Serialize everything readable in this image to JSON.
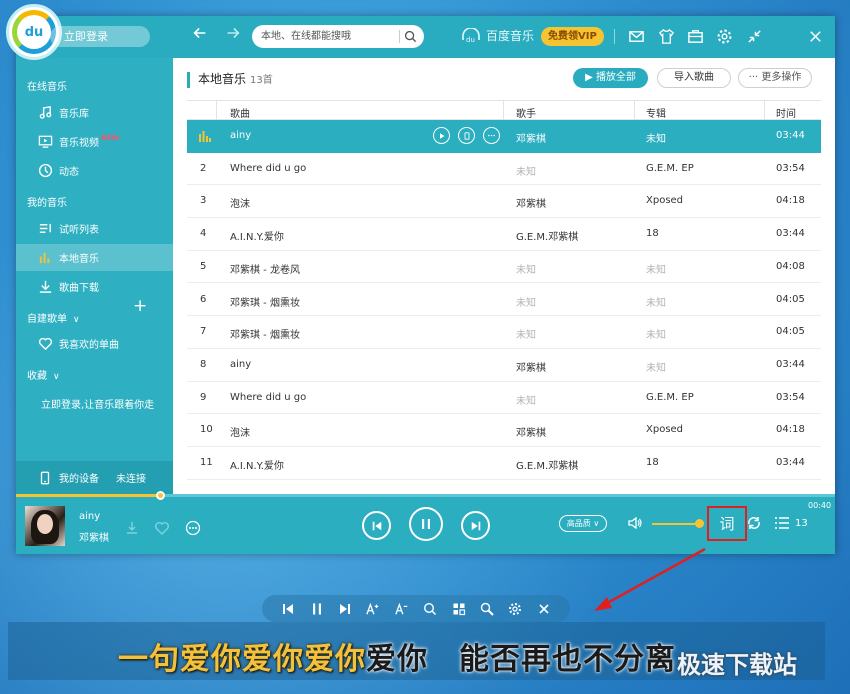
{
  "topbar": {
    "login_label": "立即登录",
    "search_placeholder": "本地、在线都能搜哦",
    "brand": "百度音乐",
    "vip_label": "免费领VIP"
  },
  "sidebar": {
    "section_online": "在线音乐",
    "item_library": "音乐库",
    "item_mv": "音乐视频",
    "new_badge": "NEW",
    "item_feed": "动态",
    "section_mine": "我的音乐",
    "item_trial": "试听列表",
    "item_local": "本地音乐",
    "item_download": "歌曲下载",
    "section_custom": "自建歌单",
    "item_fav": "我喜欢的单曲",
    "section_collect": "收藏",
    "login_hint": "立即登录,让音乐跟着你走",
    "device_label": "我的设备",
    "device_status": "未连接"
  },
  "content": {
    "title": "本地音乐",
    "count": "13首",
    "play_all": "播放全部",
    "import": "导入歌曲",
    "more": "··· 更多操作",
    "headers": {
      "song": "歌曲",
      "artist": "歌手",
      "album": "专辑",
      "time": "时间"
    },
    "rows": [
      {
        "num": "",
        "song": "ainy",
        "artist": "邓紫棋",
        "album": "未知",
        "time": "03:44",
        "artist_dim": false,
        "album_dim": false
      },
      {
        "num": "2",
        "song": "Where did u go",
        "artist": "未知",
        "album": "G.E.M. EP",
        "time": "03:54",
        "artist_dim": true,
        "album_dim": false
      },
      {
        "num": "3",
        "song": "泡沫",
        "artist": "邓紫棋",
        "album": "Xposed",
        "time": "04:18",
        "artist_dim": false,
        "album_dim": false
      },
      {
        "num": "4",
        "song": "A.I.N.Y.爱你",
        "artist": "G.E.M.邓紫棋",
        "album": "18",
        "time": "03:44",
        "artist_dim": false,
        "album_dim": false
      },
      {
        "num": "5",
        "song": "邓紫棋 - 龙卷风",
        "artist": "未知",
        "album": "未知",
        "time": "04:08",
        "artist_dim": true,
        "album_dim": true
      },
      {
        "num": "6",
        "song": "邓紫琪 - 烟熏妆",
        "artist": "未知",
        "album": "未知",
        "time": "04:05",
        "artist_dim": true,
        "album_dim": true
      },
      {
        "num": "7",
        "song": "邓紫琪 - 烟熏妆",
        "artist": "未知",
        "album": "未知",
        "time": "04:05",
        "artist_dim": true,
        "album_dim": true
      },
      {
        "num": "8",
        "song": "ainy",
        "artist": "邓紫棋",
        "album": "未知",
        "time": "03:44",
        "artist_dim": false,
        "album_dim": true
      },
      {
        "num": "9",
        "song": "Where did u go",
        "artist": "未知",
        "album": "G.E.M. EP",
        "time": "03:54",
        "artist_dim": true,
        "album_dim": false
      },
      {
        "num": "10",
        "song": "泡沫",
        "artist": "邓紫棋",
        "album": "Xposed",
        "time": "04:18",
        "artist_dim": false,
        "album_dim": false
      },
      {
        "num": "11",
        "song": "A.I.N.Y.爱你",
        "artist": "G.E.M.邓紫棋",
        "album": "18",
        "time": "03:44",
        "artist_dim": false,
        "album_dim": false
      }
    ]
  },
  "player": {
    "total_time": "00:40",
    "progress": 0.177,
    "song": "ainy",
    "artist": "邓紫棋",
    "quality": "高品质",
    "volume": 1.0,
    "lyric_button": "词",
    "queue_count": "13"
  },
  "lyrics": {
    "sung": "一句爱你爱你爱你",
    "rest": "爱你　能否再也不分离"
  },
  "watermark": "极速下载站",
  "colors": {
    "accent": "#29acbf",
    "highlight": "#f7c431",
    "annotation": "#e02020"
  }
}
